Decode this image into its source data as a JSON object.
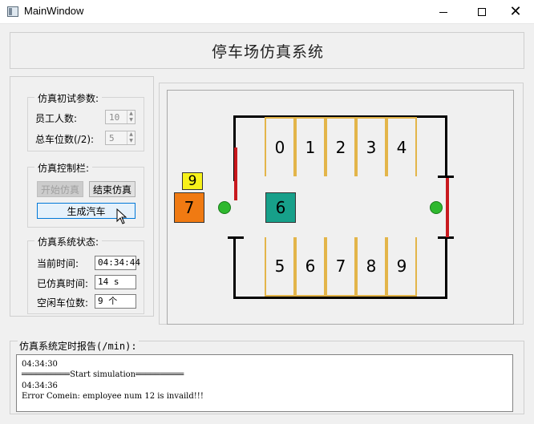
{
  "window": {
    "title": "MainWindow",
    "minimize": "—",
    "maximize": "□",
    "close": "✕"
  },
  "header": {
    "title": "停车场仿真系统"
  },
  "params": {
    "title": "仿真初试参数:",
    "employee_label": "员工人数:",
    "employee_value": "10",
    "spots_label": "总车位数(/2):",
    "spots_value": "5"
  },
  "control": {
    "title": "仿真控制栏:",
    "start_label": "开始仿真",
    "stop_label": "结束仿真",
    "generate_label": "生成汽车"
  },
  "status": {
    "title": "仿真系统状态:",
    "current_time_label": "当前时间:",
    "current_time_value": "04:34:44",
    "elapsed_label": "已仿真时间:",
    "elapsed_value": "14 s",
    "free_label": "空闲车位数:",
    "free_value": "9 个"
  },
  "scene": {
    "top_spots": [
      "0",
      "1",
      "2",
      "3",
      "4"
    ],
    "bottom_spots": [
      "5",
      "6",
      "7",
      "8",
      "9"
    ],
    "cars": [
      {
        "id": "9",
        "color": "#f7f21a"
      },
      {
        "id": "7",
        "color": "#f07a12"
      },
      {
        "id": "6",
        "color": "#17a08a"
      }
    ],
    "gate_color": "#c8191e",
    "lamp_color": "#2eb82e",
    "spot_line_color": "#e3b54a"
  },
  "report": {
    "title": "仿真系统定时报告(/min):",
    "lines": [
      "04:34:30",
      "══════════Start simulation══════════",
      "04:34:36",
      "Error Comein: employee num 12 is invaild!!!"
    ]
  }
}
